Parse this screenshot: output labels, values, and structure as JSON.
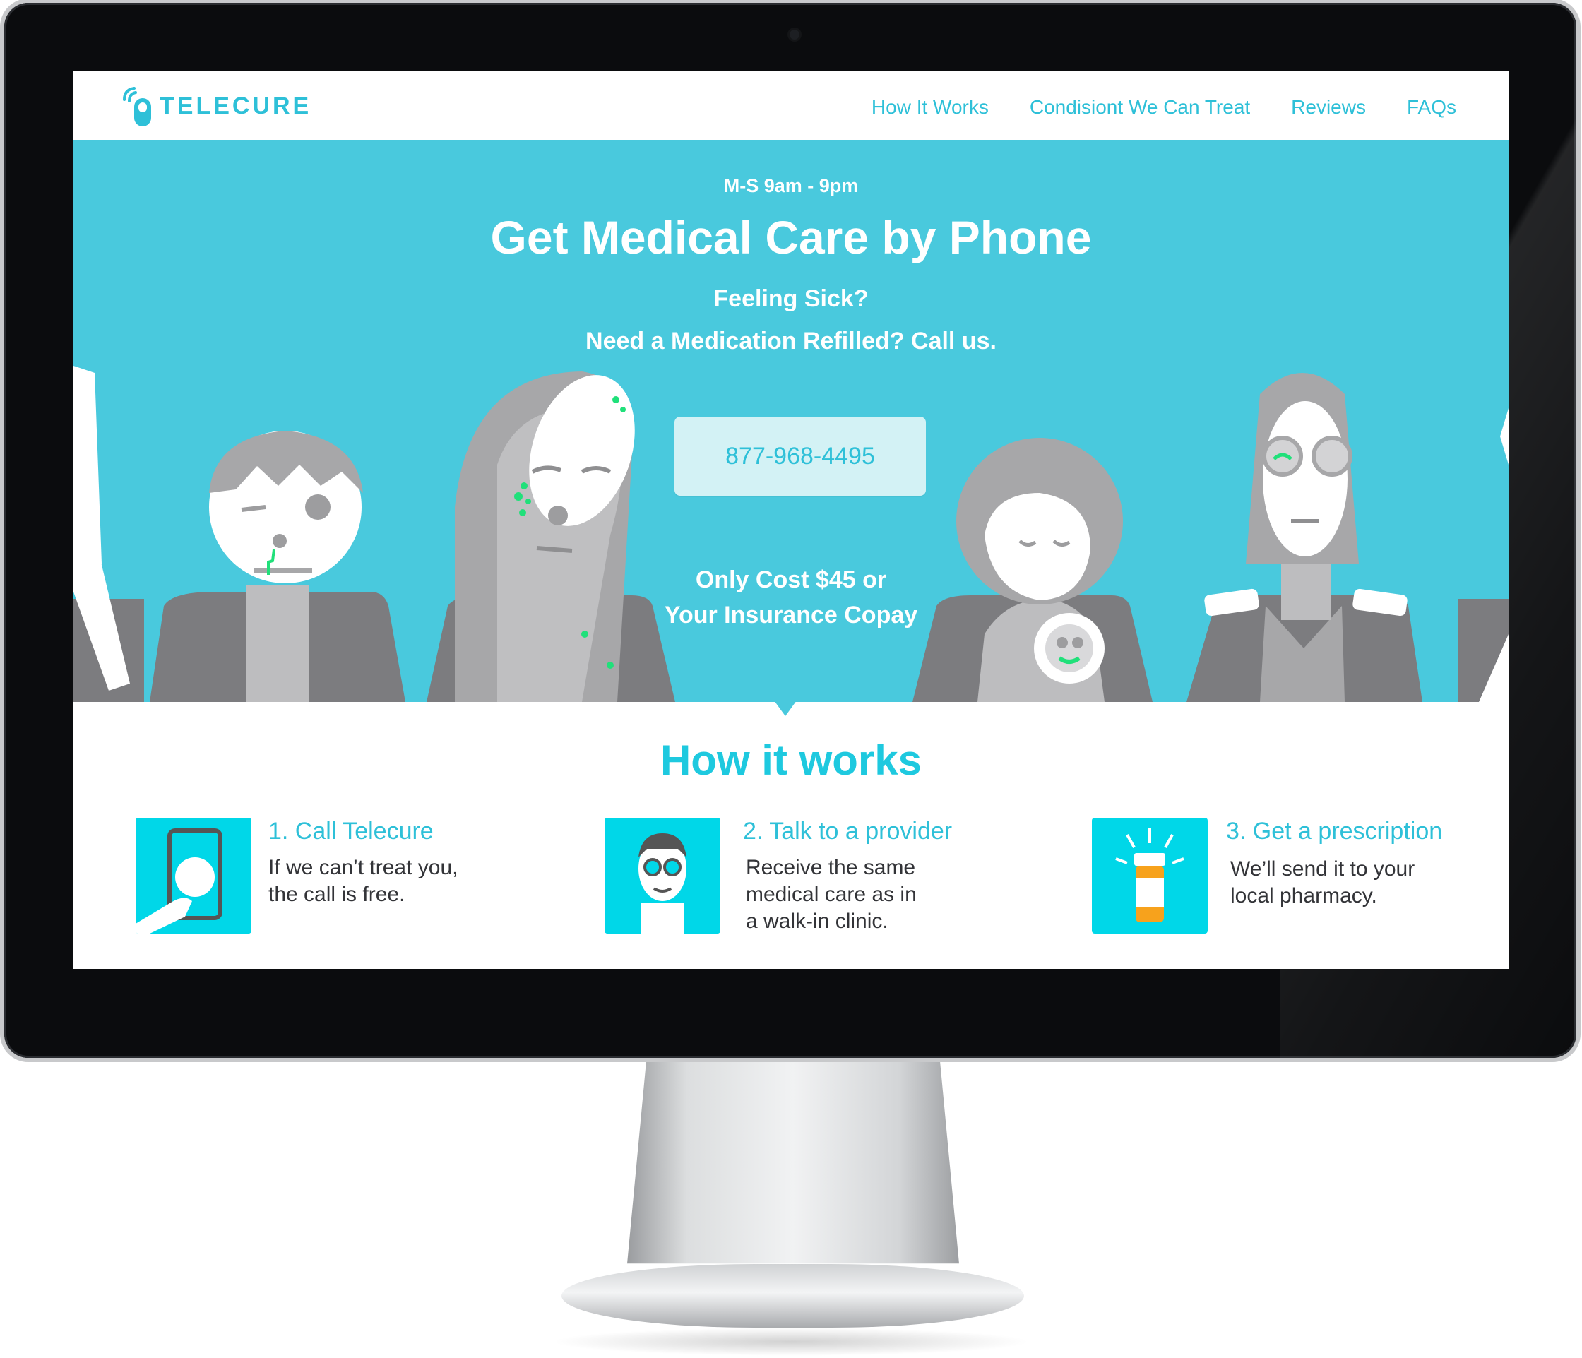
{
  "brand": {
    "name": "TELECURE",
    "accent": "#2ec0d8",
    "hero_bg": "#49c9dd",
    "icon_bg": "#00d7e8"
  },
  "nav": {
    "items": [
      {
        "label": "How It Works"
      },
      {
        "label": "Condisiont We Can Treat"
      },
      {
        "label": "Reviews"
      },
      {
        "label": "FAQs"
      }
    ]
  },
  "hero": {
    "hours": "M-S  9am - 9pm",
    "headline": "Get Medical Care by Phone",
    "sub_line_1": "Feeling Sick?",
    "sub_line_2": "Need a Medication Refilled? Call us.",
    "phone_button": "877-968-4495",
    "cost_line_1": "Only Cost $45 or",
    "cost_line_2": "Your Insurance Copay"
  },
  "how_it_works": {
    "title": "How it works",
    "steps": [
      {
        "title": "1. Call Telecure",
        "desc_lines": [
          "If we can’t treat you,",
          "the call is free."
        ],
        "icon": "phone-tap-icon"
      },
      {
        "title": "2. Talk to a provider",
        "desc_lines": [
          "Receive the same",
          "medical care as in",
          "a walk-in clinic."
        ],
        "icon": "doctor-icon"
      },
      {
        "title": "3. Get a prescription",
        "desc_lines": [
          "We’ll send it to your",
          "local pharmacy."
        ],
        "icon": "pill-bottle-icon"
      }
    ]
  }
}
